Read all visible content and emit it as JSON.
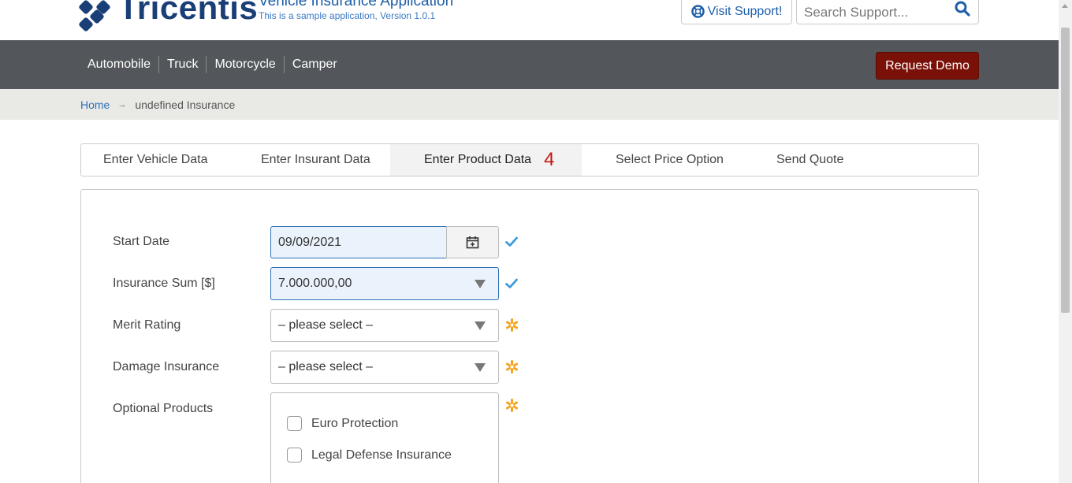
{
  "header": {
    "logo_text": "Tricentis",
    "app_title": "Vehicle Insurance Application",
    "app_subtitle": "This is a sample application, Version 1.0.1",
    "support_label": "Visit Support!",
    "search_placeholder": "Search Support..."
  },
  "nav": {
    "items": [
      "Automobile",
      "Truck",
      "Motorcycle",
      "Camper"
    ],
    "demo_label": "Request Demo",
    "demo_color": "#7a1108",
    "bar_color": "#53575c"
  },
  "breadcrumb": {
    "home": "Home",
    "arrow": "→",
    "current": "undefined Insurance"
  },
  "tabs": [
    {
      "label": "Enter Vehicle Data",
      "active": false
    },
    {
      "label": "Enter Insurant Data",
      "active": false
    },
    {
      "label": "Enter Product Data",
      "active": true,
      "count": "4"
    },
    {
      "label": "Select Price Option",
      "active": false
    },
    {
      "label": "Send Quote",
      "active": false
    }
  ],
  "form": {
    "start_date": {
      "label": "Start Date",
      "value": "09/09/2021",
      "status_icon": "check-icon"
    },
    "insurance_sum": {
      "label": "Insurance Sum [$]",
      "value": "7.000.000,00",
      "status_icon": "check-icon"
    },
    "merit_rating": {
      "label": "Merit Rating",
      "value": "– please select –",
      "status_icon": "required-icon"
    },
    "damage_insurance": {
      "label": "Damage Insurance",
      "value": "– please select –",
      "status_icon": "required-icon"
    },
    "optional_products": {
      "label": "Optional Products",
      "status_icon": "required-icon",
      "options": [
        {
          "label": "Euro Protection",
          "checked": false
        },
        {
          "label": "Legal Defense Insurance",
          "checked": false
        }
      ]
    }
  },
  "colors": {
    "accent_blue": "#2f6fb5",
    "required_orange": "#f4a31d",
    "tab_count_red": "#c0170b"
  }
}
